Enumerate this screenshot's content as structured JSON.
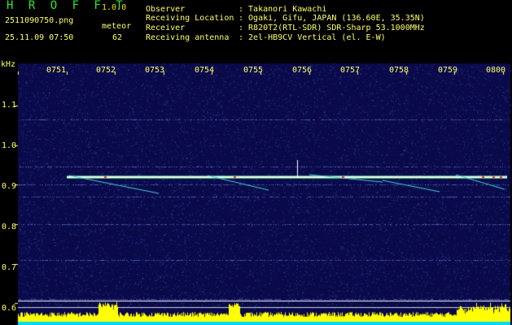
{
  "header": {
    "app_name": "H R O F F T",
    "app_version": "1.0.0",
    "file_name": "2511090750.png",
    "mode_label": "meteor",
    "timestamp": "25.11.09 07:50",
    "count": "62"
  },
  "info": [
    {
      "label": "Observer",
      "value": ": Takanori Kawachi"
    },
    {
      "label": "Receiving Location",
      "value": ": Ogaki, Gifu, JAPAN (136.60E, 35.35N)"
    },
    {
      "label": "Receiver",
      "value": ": R820T2(RTL-SDR) SDR-Sharp 53.1000MHz"
    },
    {
      "label": "Receiving antenna",
      "value": ": 2el-HB9CV Vertical (el. E-W)"
    }
  ],
  "chart_data": {
    "type": "heatmap",
    "ylabel": "kHz",
    "y_ticks": [
      "1.1",
      "1.0",
      "0.9",
      "0.8",
      "0.7",
      "0.6"
    ],
    "x_ticks": [
      "0751",
      "0752",
      "0753",
      "0754",
      "0755",
      "0756",
      "0757",
      "0758",
      "0759",
      "0800"
    ],
    "ylim": [
      0.58,
      1.18
    ],
    "xlim": [
      "0750",
      "0800"
    ],
    "carrier_khz": 0.92,
    "colors": {
      "background": "#0a0a4a",
      "carrier": "#e6ffe6",
      "trace": "#3fd3e0",
      "hot": "#ff3030",
      "spectrum_bar": "#ffff00",
      "spectrum_base": "#00d8ff"
    }
  }
}
